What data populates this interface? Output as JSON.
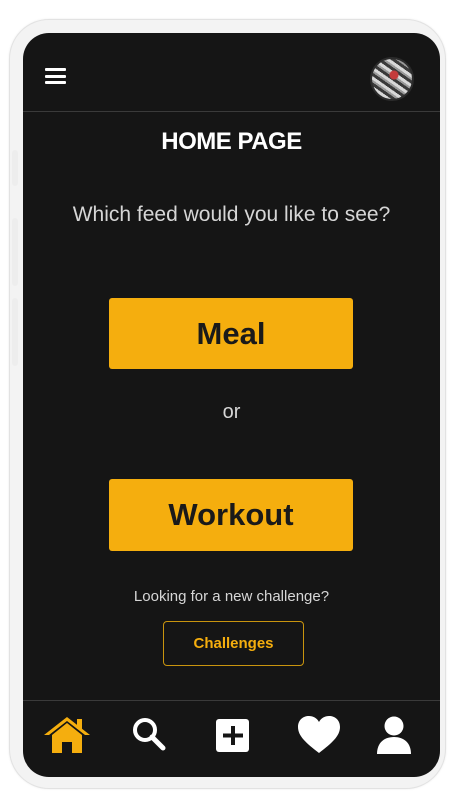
{
  "header": {
    "title": "HOME PAGE",
    "menu_icon": "hamburger-menu-icon",
    "avatar_icon": "user-avatar"
  },
  "main": {
    "prompt": "Which feed would you like to see?",
    "meal_label": "Meal",
    "or_text": "or",
    "workout_label": "Workout",
    "challenge_prompt": "Looking for a new challenge?",
    "challenges_label": "Challenges"
  },
  "bottom_nav": {
    "items": [
      {
        "icon": "home-icon",
        "active": true
      },
      {
        "icon": "search-icon",
        "active": false
      },
      {
        "icon": "add-icon",
        "active": false
      },
      {
        "icon": "heart-icon",
        "active": false
      },
      {
        "icon": "profile-icon",
        "active": false
      }
    ]
  },
  "colors": {
    "accent": "#f5ae0e",
    "background": "#151515",
    "text": "#ffffff",
    "muted_text": "#d6d6d6"
  }
}
